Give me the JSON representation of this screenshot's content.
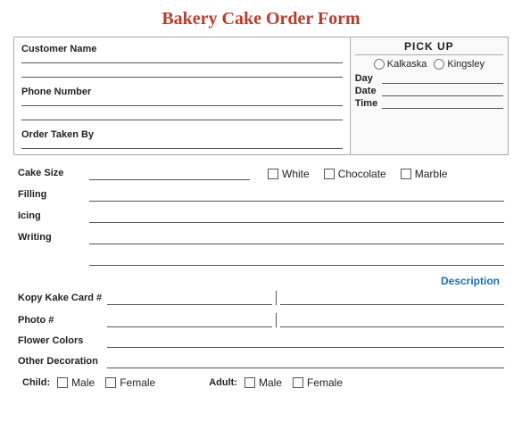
{
  "title": "Bakery Cake Order Form",
  "top_section": {
    "customer_name_label": "Customer Name",
    "phone_number_label": "Phone Number",
    "order_taken_by_label": "Order Taken By",
    "pickup": {
      "header": "PICK UP",
      "locations": [
        "Kalkaska",
        "Kingsley"
      ],
      "day_label": "Day",
      "date_label": "Date",
      "time_label": "Time"
    }
  },
  "form": {
    "cake_size_label": "Cake Size",
    "filling_label": "Filling",
    "icing_label": "Icing",
    "writing_label": "Writing",
    "checkboxes": {
      "white": "White",
      "chocolate": "Chocolate",
      "marble": "Marble"
    },
    "description_header": "Description",
    "kopy_kake_label": "Kopy Kake Card #",
    "photo_label": "Photo #",
    "flower_colors_label": "Flower Colors",
    "other_decoration_label": "Other Decoration"
  },
  "child_adult": {
    "child_label": "Child:",
    "adult_label": "Adult:",
    "male_label": "Male",
    "female_label": "Female"
  }
}
